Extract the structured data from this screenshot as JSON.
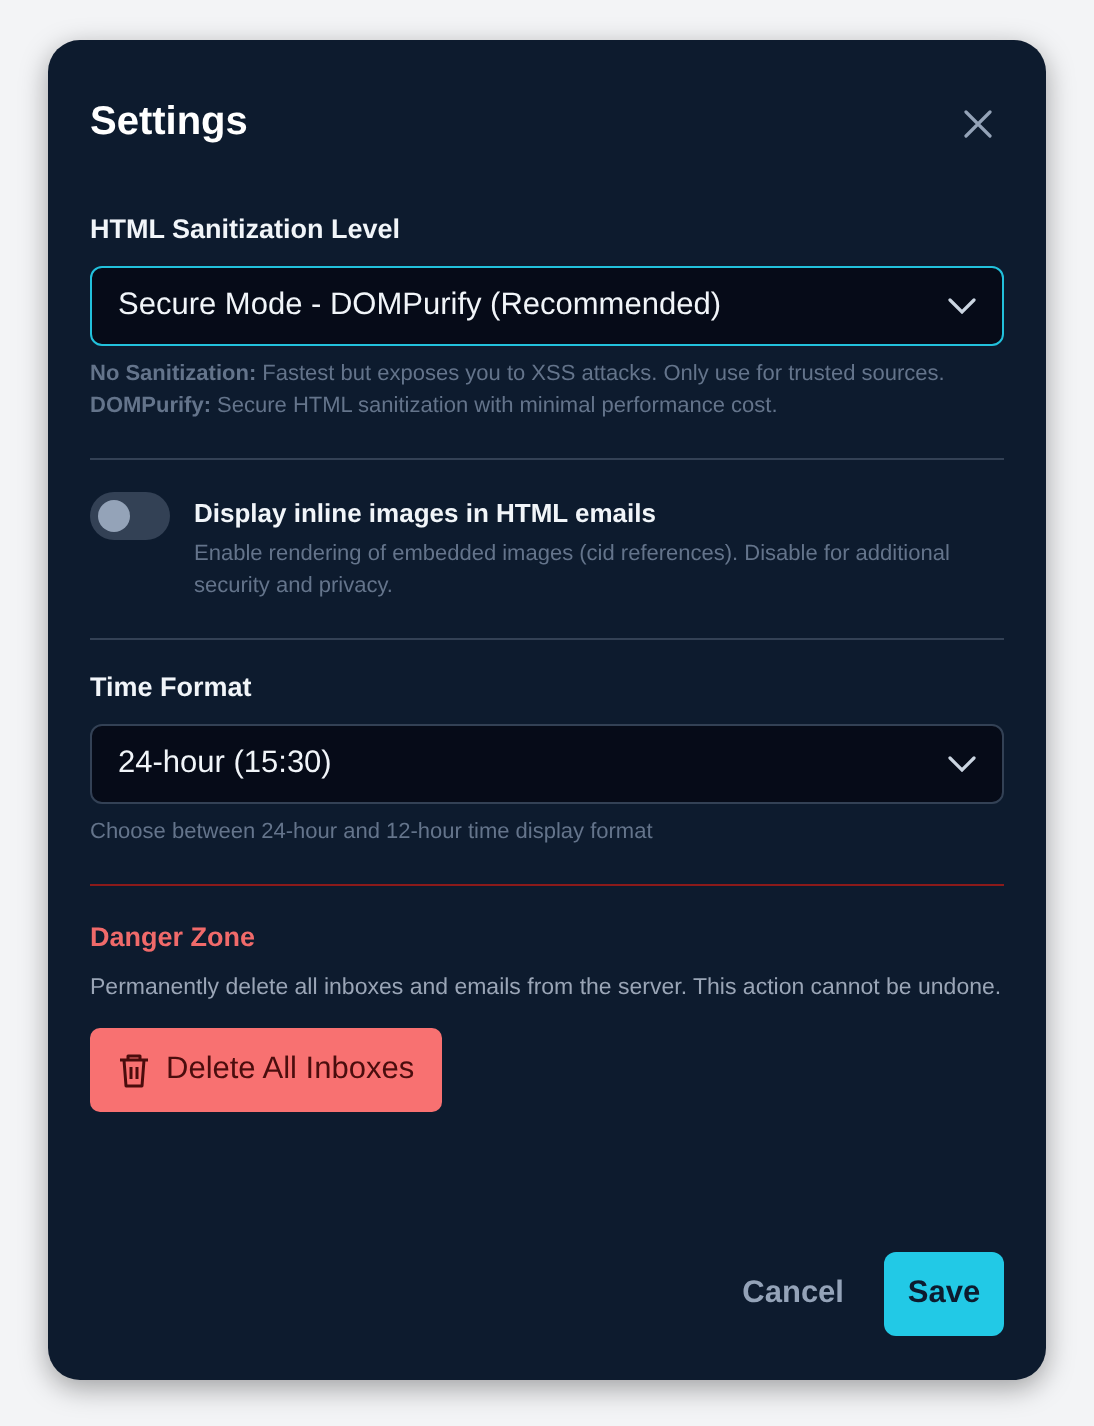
{
  "dialog": {
    "title": "Settings",
    "sanitization": {
      "label": "HTML Sanitization Level",
      "value": "Secure Mode - DOMPurify (Recommended)",
      "focused": true,
      "help": "**No Sanitization:** Fastest but exposes you to XSS attacks. Only use for trusted sources. **DOMPurify:** Secure HTML sanitization with minimal performance cost."
    },
    "inline_images": {
      "label": "Display inline images in HTML emails",
      "on": false,
      "help": "Enable rendering of embedded images (cid references). Disable for additional security and privacy."
    },
    "time_format": {
      "label": "Time Format",
      "value": "24-hour (15:30)",
      "focused": false,
      "help": "Choose between 24-hour and 12-hour time display format"
    },
    "danger_zone": {
      "title": "Danger Zone",
      "text": "Permanently delete all inboxes and emails from the server. This action cannot be undone.",
      "button": "Delete All Inboxes"
    },
    "buttons": {
      "cancel": "Cancel",
      "save": "Save"
    }
  }
}
